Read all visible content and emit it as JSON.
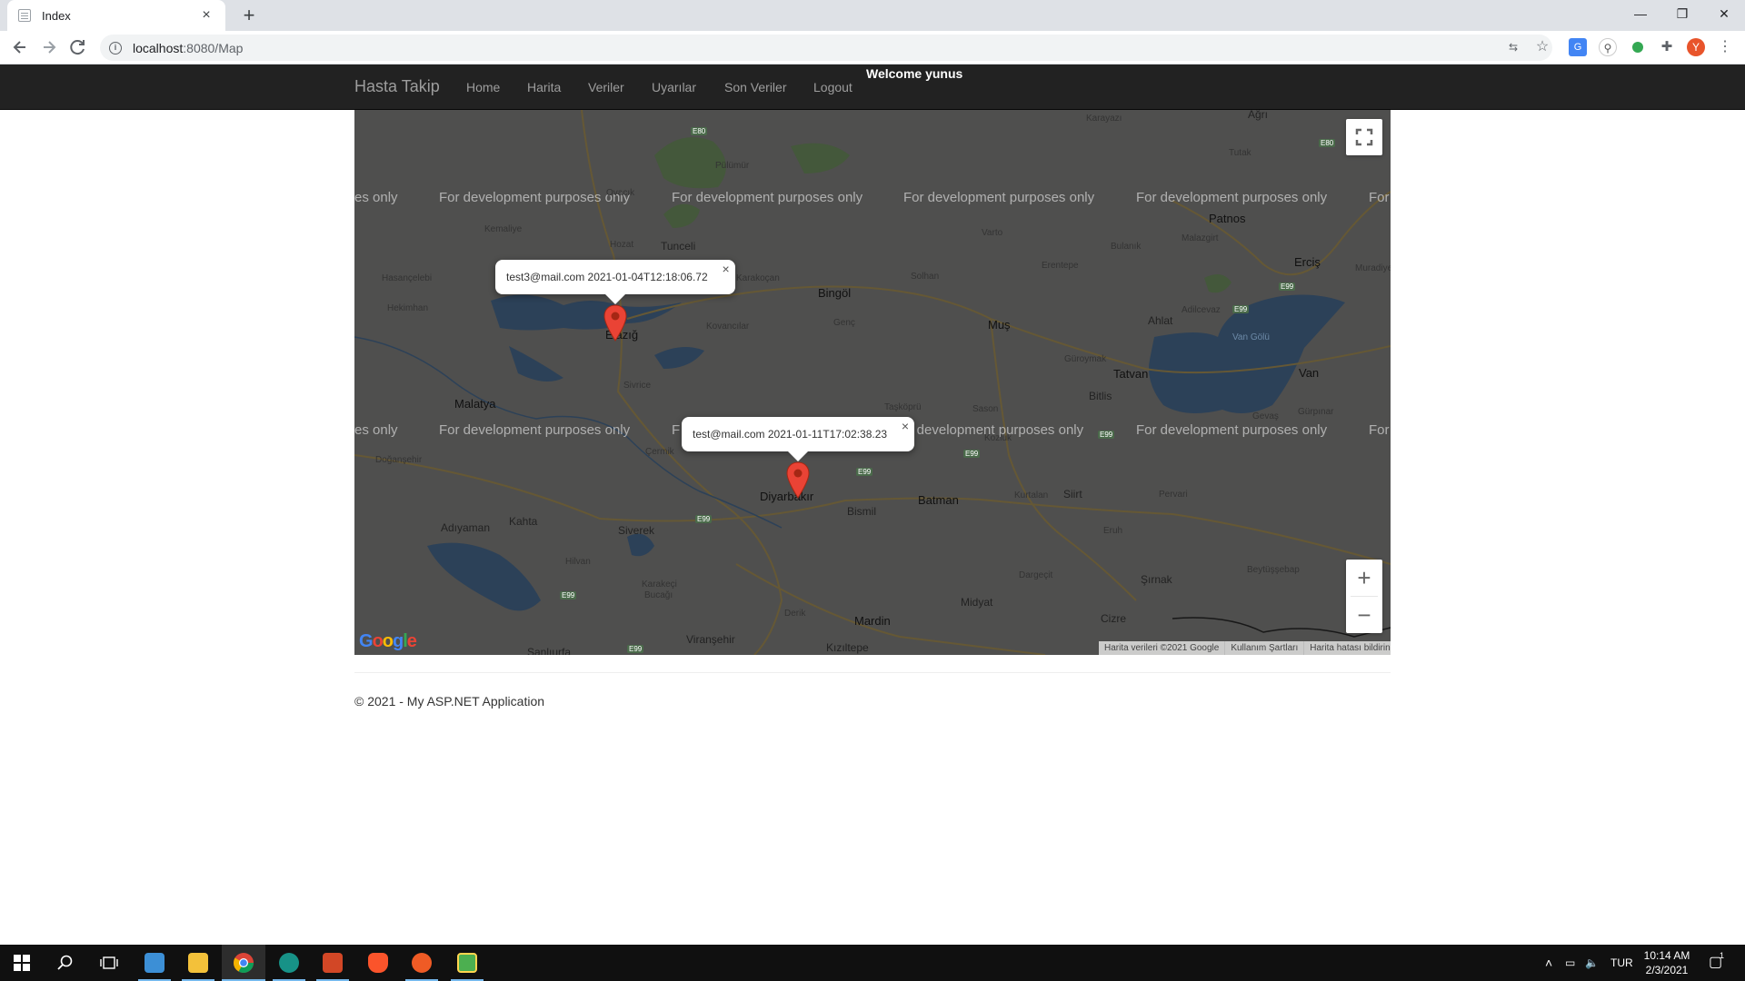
{
  "browser": {
    "tab_title": "Index",
    "tab_close": "×",
    "new_tab": "+",
    "url_host": "localhost",
    "url_path": ":8080/Map",
    "window_controls": {
      "minimize": "—",
      "restore": "❐",
      "close": "✕"
    },
    "profile_initial": "Y"
  },
  "navbar": {
    "brand": "Hasta Takip",
    "links": [
      "Home",
      "Harita",
      "Veriler",
      "Uyarılar",
      "Son Veriler",
      "Logout"
    ],
    "welcome": "Welcome yunus"
  },
  "map": {
    "watermark": "For development purposes only",
    "watermark_partial_left": "es only",
    "watermark_partial_right": "For",
    "watermark_partial_mid": "F",
    "places": {
      "karayazi": "Karayazı",
      "agri": "Ağrı",
      "tutak": "Tutak",
      "pulumur": "Pülümür",
      "ovacik": "Ovacık",
      "kemaliye": "Kemaliye",
      "hozat": "Hozat",
      "tunceli": "Tunceli",
      "karakocan": "Karakoçan",
      "hasancelebi": "Hasançelebi",
      "hekimhan": "Hekimhan",
      "bingol": "Bingöl",
      "solhan": "Solhan",
      "genc": "Genç",
      "kovancilar": "Kovancılar",
      "elazig": "Elazığ",
      "malatya": "Malatya",
      "sivrice": "Sivrice",
      "mus": "Muş",
      "varto": "Varto",
      "bulanik": "Bulanık",
      "erentepe": "Erentepe",
      "malazgirt": "Malazgirt",
      "patnos": "Patnos",
      "ercis": "Erciş",
      "muradiye": "Muradiye",
      "adilcevaz": "Adilcevaz",
      "ahlat": "Ahlat",
      "tatvan": "Tatvan",
      "guroymak": "Güroymak",
      "bitlis": "Bitlis",
      "van": "Van",
      "van_golu": "Van Gölü",
      "gevas": "Gevaş",
      "gurpinar": "Gürpınar",
      "taskopru": "Taşköprü",
      "sason": "Sason",
      "kozluk": "Kozluk",
      "dogansehir": "Doğanşehir",
      "cermik": "Çermik",
      "diyarbakir": "Diyarbakır",
      "bismil": "Bismil",
      "batman": "Batman",
      "kurtalan": "Kurtalan",
      "siirt": "Siirt",
      "pervari": "Pervari",
      "adiyaman": "Adıyaman",
      "kahta": "Kahta",
      "siverek": "Siverek",
      "hilvan": "Hilvan",
      "karakecili": "Karakeçi",
      "bucagi": "Bucağı",
      "eruh": "Eruh",
      "dargecit": "Dargeçit",
      "sirnak": "Şırnak",
      "beytussebap": "Beytüşşebap",
      "midyat": "Midyat",
      "mardin": "Mardin",
      "derik": "Derik",
      "cizre": "Cizre",
      "viransehir": "Viranşehir",
      "kiziltepe": "Kızıltepe",
      "sanliurfa": "Şanlıurfa"
    },
    "shields": {
      "e80": "E80",
      "e99": "E99"
    },
    "markers": [
      {
        "popup": "test3@mail.com 2021-01-04T12:18:06.72"
      },
      {
        "popup": "test@mail.com 2021-01-11T17:02:38.23"
      }
    ],
    "popup_close": "×",
    "zoom_in": "+",
    "zoom_out": "−",
    "google_logo": "Google",
    "attribution": [
      "Harita verileri ©2021 Google",
      "Kullanım Şartları",
      "Harita hatası bildirin"
    ]
  },
  "footer": {
    "text": "© 2021 - My ASP.NET Application"
  },
  "taskbar": {
    "language": "TUR",
    "time": "10:14 AM",
    "date": "2/3/2021",
    "notification_count": "1"
  }
}
